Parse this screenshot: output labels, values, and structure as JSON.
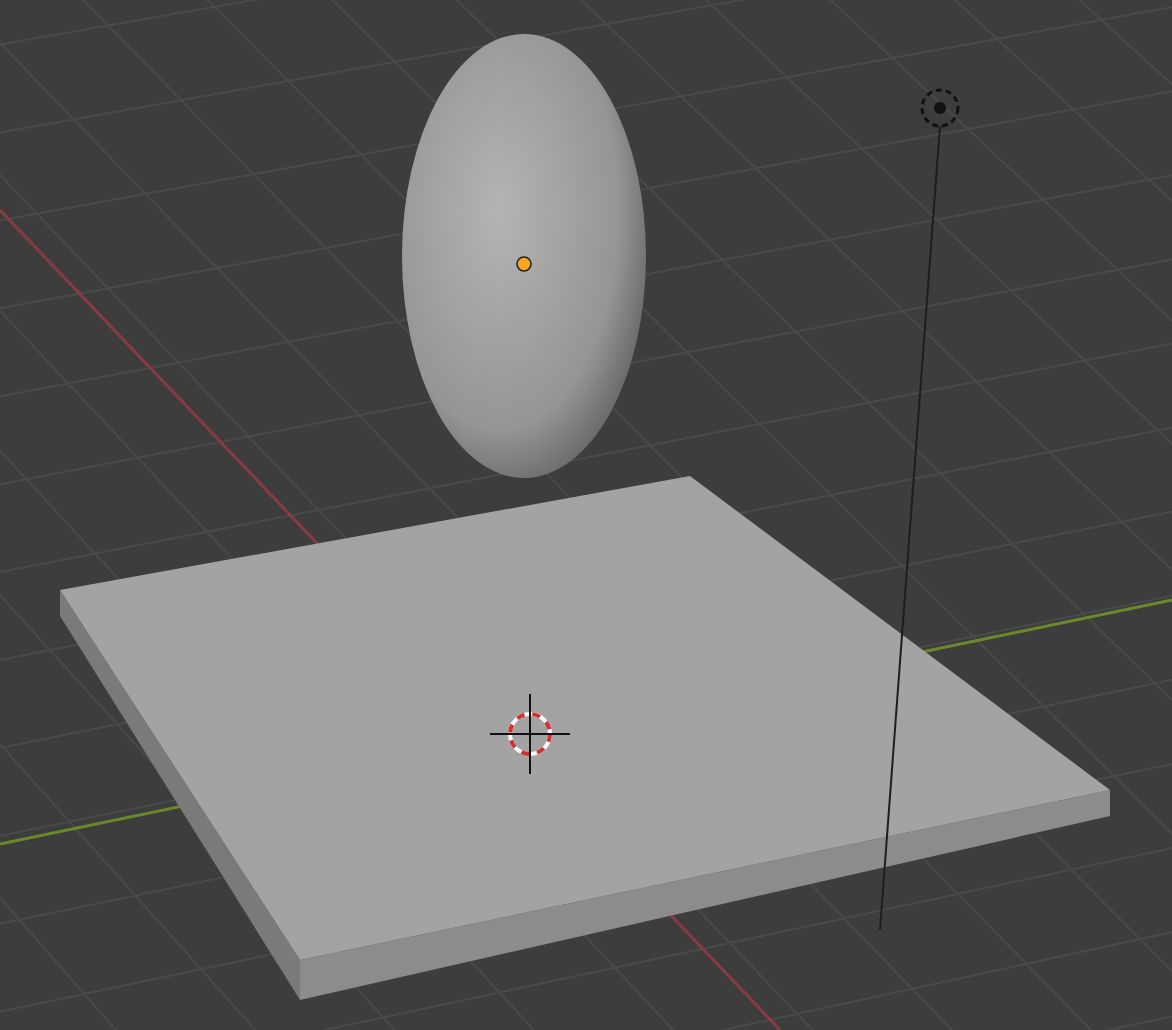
{
  "viewport": {
    "objects": [
      {
        "kind": "plane",
        "selected": false
      },
      {
        "kind": "ellipsoid",
        "selected": true
      },
      {
        "kind": "light",
        "selected": false
      }
    ],
    "show_cursor": true
  }
}
